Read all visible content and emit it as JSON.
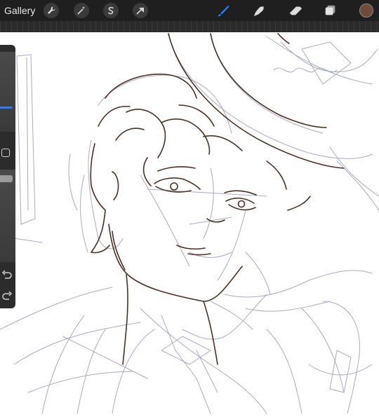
{
  "toolbar": {
    "gallery_label": "Gallery",
    "left_tools": [
      {
        "name": "actions",
        "icon": "wrench-icon"
      },
      {
        "name": "adjustments",
        "icon": "magic-wand-icon"
      },
      {
        "name": "selection",
        "icon": "selection-s-icon"
      },
      {
        "name": "transform",
        "icon": "arrow-cursor-icon"
      }
    ],
    "right_tools": [
      {
        "name": "brush",
        "icon": "brush-icon",
        "active": true
      },
      {
        "name": "smudge",
        "icon": "smudge-icon"
      },
      {
        "name": "eraser",
        "icon": "eraser-icon"
      },
      {
        "name": "layers",
        "icon": "layers-icon"
      }
    ],
    "active_color": "#6e4b3a",
    "accent_color": "#2f7df6"
  },
  "sidebar": {
    "brush_size_level": 0.3,
    "opacity_level": 0.05,
    "undo_icon": "undo-icon",
    "redo_icon": "redo-icon"
  },
  "canvas": {
    "sketch_color": "#a9abbf",
    "lineart_color": "#4a3128"
  }
}
